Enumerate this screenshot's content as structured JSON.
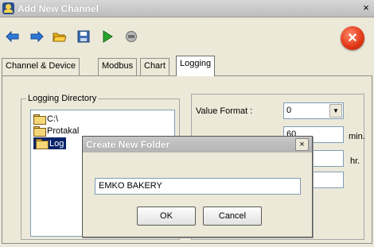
{
  "window": {
    "title": "Add New Channel",
    "close_glyph": "×"
  },
  "toolbar": {
    "buttons": [
      {
        "icon": "arrow-left-icon",
        "color": "#2e78d6"
      },
      {
        "icon": "arrow-right-icon",
        "color": "#2e78d6"
      },
      {
        "icon": "open-folder-icon",
        "color": "#f2b21a"
      },
      {
        "icon": "save-icon",
        "color": "#3d6fb2"
      },
      {
        "icon": "play-icon",
        "color": "#27a32e"
      },
      {
        "icon": "stop-icon",
        "color": "#8c8c8c"
      }
    ],
    "exit_glyph": "×"
  },
  "tabs": [
    {
      "label": "Channel & Device"
    },
    {
      "label": "Modbus"
    },
    {
      "label": "Chart"
    },
    {
      "label": "Logging"
    }
  ],
  "active_tab": "Logging",
  "logging": {
    "directory_group_label": "Logging Directory",
    "tree": [
      {
        "label": "C:\\"
      },
      {
        "label": "Protakal"
      },
      {
        "label": "Log"
      }
    ],
    "value_format_label": "Value Format :",
    "value_format_value": "0",
    "field2_value": "60",
    "unit_min": "min.",
    "unit_hr": "hr."
  },
  "dialog": {
    "title": "Create New Folder",
    "close_glyph": "×",
    "input_value": "EMKO BAKERY",
    "ok_label": "OK",
    "cancel_label": "Cancel"
  }
}
